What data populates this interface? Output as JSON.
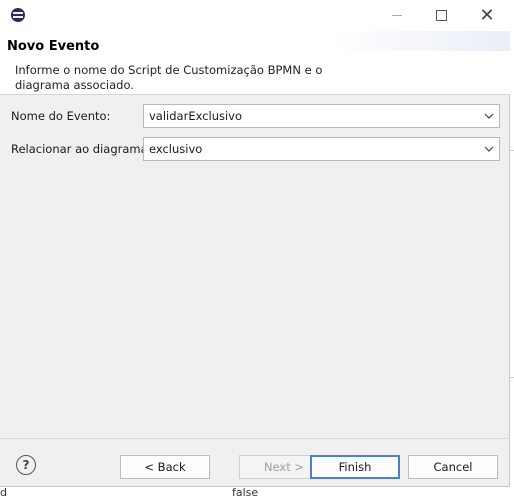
{
  "background": {
    "fragment_bottom_left": "d",
    "fragment_bottom_mid": "false"
  },
  "window": {
    "title": ""
  },
  "header": {
    "title": "Novo Evento",
    "description": "Informe o nome do Script de Customização BPMN e o diagrama associado."
  },
  "form": {
    "event_name_label": "Nome do Evento:",
    "event_name_value": "validarExclusivo",
    "diagram_label": "Relacionar ao diagrama:",
    "diagram_value": "exclusivo"
  },
  "buttons": {
    "help": "?",
    "back": "< Back",
    "next": "Next >",
    "finish": "Finish",
    "cancel": "Cancel"
  },
  "colors": {
    "dialog_bg": "#f0f0f0",
    "header_bg": "#ffffff",
    "default_button_border": "#4a7fd0"
  }
}
